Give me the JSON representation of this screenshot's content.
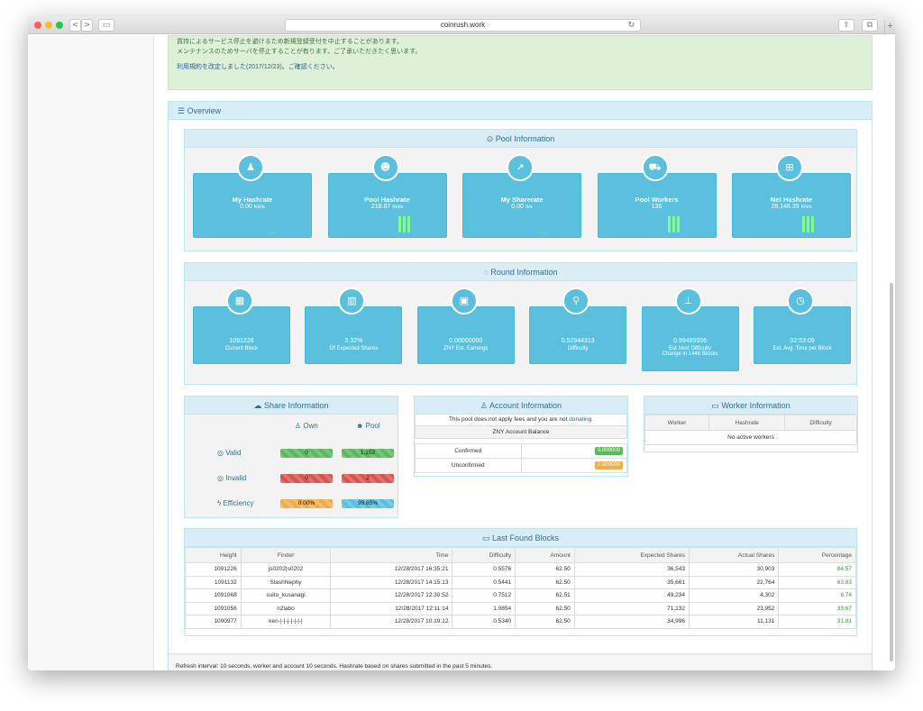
{
  "browser": {
    "url": "coinrush.work",
    "nav_back": "<",
    "nav_fwd": ">",
    "reload_icon": "↻",
    "plus": "+"
  },
  "notice": {
    "line1": "貨持によるサービス停止を避けるため新規登録受付を中止することがあります。",
    "line2": "メンテナンスのためサーバを停止することが有ります。ご了承いただきたく思います。",
    "line3": "利用規約を改定しました(2017/12/23)。ご確認ください。",
    "link_text": "利用規約"
  },
  "overview": {
    "title": "Overview"
  },
  "pool_info": {
    "title": "Pool Information",
    "cards": [
      {
        "label": "My Hashrate",
        "value": "0.00",
        "unit": "KH/s",
        "icon": "person-icon",
        "glyph": "♟"
      },
      {
        "label": "Pool Hashrate",
        "value": "218.87",
        "unit": "KH/s",
        "icon": "users-icon",
        "glyph": "☻"
      },
      {
        "label": "My Sharerate",
        "value": "0.00",
        "unit": "S/s",
        "icon": "share-icon",
        "glyph": "↗"
      },
      {
        "label": "Pool Workers",
        "value": "136",
        "unit": "",
        "icon": "truck-icon",
        "glyph": "⛟"
      },
      {
        "label": "Net Hashrate",
        "value": "28,146.35",
        "unit": "KH/s",
        "icon": "hospital-icon",
        "glyph": "⊞"
      }
    ]
  },
  "round_info": {
    "title": "Round Information",
    "cards": [
      {
        "value": "1091226",
        "label": "Current Block",
        "label2": "",
        "icon": "th-large-icon",
        "glyph": "▦"
      },
      {
        "value": "3.32%",
        "label": "Of Expected Shares",
        "label2": "",
        "icon": "bar-chart-icon",
        "glyph": "▥"
      },
      {
        "value": "0.00000000",
        "label": "ZNY Est. Earnings",
        "label2": "",
        "icon": "money-icon",
        "glyph": "▣"
      },
      {
        "value": "0.52944313",
        "label": "Difficulty",
        "label2": "",
        "icon": "map-marker-icon",
        "glyph": "⚲"
      },
      {
        "value": "0.99489656",
        "label": "Est Next Difficulty",
        "label2": "Change in 1446 Blocks",
        "icon": "sitemap-icon",
        "glyph": "⊥"
      },
      {
        "value": "02:53:09",
        "label": "Est. Avg. Time per Block",
        "label2": "",
        "icon": "clock-icon",
        "glyph": "◷"
      }
    ]
  },
  "share_info": {
    "title": "Share Information",
    "own": "Own",
    "pool": "Pool",
    "rows": [
      {
        "label": "Valid",
        "own": "0",
        "pool": "1,152",
        "own_color": "green",
        "pool_color": "green"
      },
      {
        "label": "Invalid",
        "own": "0",
        "pool": "2",
        "own_color": "red",
        "pool_color": "red"
      },
      {
        "label": "Efficiency",
        "own": "0.00%",
        "pool": "99.85%",
        "own_color": "orange",
        "pool_color": "blue"
      }
    ]
  },
  "account_info": {
    "title": "Account Information",
    "fee_note": "This pool does not apply fees and you are not",
    "fee_link": "donating.",
    "balance_header": "ZNY Account Balance",
    "rows": [
      {
        "label": "Confirmed",
        "value": "0.000000",
        "color": "#5cb85c"
      },
      {
        "label": "Unconfirmed",
        "value": "0.000000",
        "color": "#f0ad4e"
      }
    ]
  },
  "worker_info": {
    "title": "Worker Information",
    "headers": [
      "Worker",
      "Hashrate",
      "Difficulty"
    ],
    "empty": "No active workers"
  },
  "last_blocks": {
    "title": "Last Found Blocks",
    "headers": [
      "Height",
      "Finder",
      "Time",
      "Difficulty",
      "Amount",
      "Expected Shares",
      "Actual Shares",
      "Percentage"
    ],
    "rows": [
      [
        "1091226",
        "js0202|s0202",
        "12/28/2017 16:35:21",
        "0.5576",
        "62.50",
        "36,543",
        "30,903",
        "84.57"
      ],
      [
        "1091132",
        "SlashNephy",
        "12/28/2017 14:15:13",
        "0.5441",
        "62.50",
        "35,661",
        "22,764",
        "63.83"
      ],
      [
        "1091068",
        "suito_kusanagi",
        "12/28/2017 12:30:52",
        "0.7512",
        "62.51",
        "49,234",
        "4,302",
        "8.74"
      ],
      [
        "1091056",
        "n2labo",
        "12/28/2017 12:11:14",
        "1.0854",
        "62.50",
        "71,132",
        "23,952",
        "33.67"
      ],
      [
        "1090977",
        "ken-|-|-|-|-|-|-|",
        "12/28/2017 10:19:12",
        "0.5340",
        "62.50",
        "34,996",
        "11,131",
        "31.81"
      ]
    ]
  },
  "footer": {
    "text": "Refresh interval: 10 seconds, worker and account 10 seconds. Hashrate based on shares submitted in the past 5 minutes."
  },
  "colors": {
    "info": "#5bc0de",
    "panel_head": "#d9edf7",
    "green": "#5cb85c",
    "red": "#d9534f",
    "orange": "#f0ad4e"
  }
}
